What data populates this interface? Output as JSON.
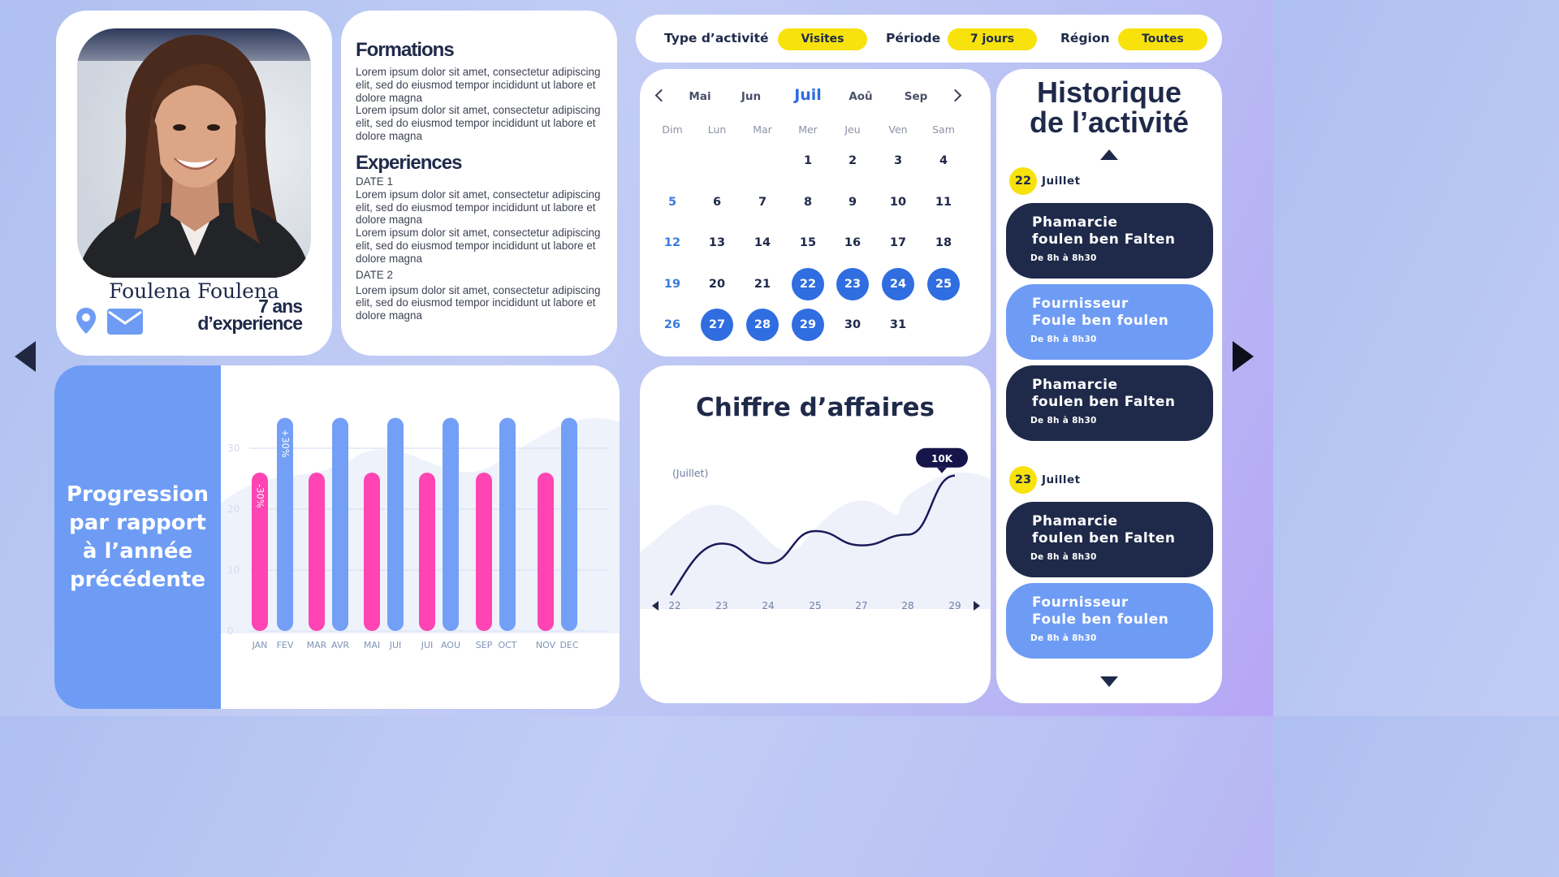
{
  "profile": {
    "name": "Foulena Foulena",
    "experience_line1": "7 ans",
    "experience_line2": "d’experience"
  },
  "cv": {
    "formations_heading": "Formations",
    "formations_items": [
      "Lorem ipsum dolor sit amet, consectetur adipiscing elit, sed do eiusmod tempor incididunt ut labore et dolore magna",
      "Lorem ipsum dolor sit amet, consectetur adipiscing elit, sed do eiusmod tempor incididunt ut labore et dolore magna"
    ],
    "experiences_heading": "Experiences",
    "date1": "DATE 1",
    "date1_items": [
      "Lorem ipsum dolor sit amet, consectetur adipiscing elit, sed do eiusmod tempor incididunt ut labore et dolore magna",
      "Lorem ipsum dolor sit amet, consectetur adipiscing elit, sed do eiusmod tempor incididunt ut labore et dolore magna"
    ],
    "date2": "DATE 2",
    "date2_items": [
      "Lorem ipsum dolor sit amet, consectetur adipiscing elit, sed do eiusmod tempor incididunt ut labore et dolore magna"
    ]
  },
  "filters": {
    "type_label": "Type d’activité",
    "type_value": "Visites",
    "period_label": "Période",
    "period_value": "7 jours",
    "region_label": "Région",
    "region_value": "Toutes"
  },
  "calendar": {
    "months": [
      "Mai",
      "Jun",
      "Juil",
      "Aoû",
      "Sep"
    ],
    "active_month": "Juil",
    "weekdays": [
      "Dim",
      "Lun",
      "Mar",
      "Mer",
      "Jeu",
      "Ven",
      "Sam"
    ],
    "first_weekday_index": 3,
    "days_in_month": 31,
    "selected_days": [
      22,
      23,
      24,
      25,
      27,
      28,
      29
    ],
    "accent_color": "#2f6de0"
  },
  "history": {
    "title_line1": "Historique",
    "title_line2": "de l’activité",
    "groups": [
      {
        "day": "22",
        "month": "Juillet",
        "items": [
          {
            "line1": "Phamarcie",
            "line2": "foulen ben Falten",
            "time": "De 8h à 8h30",
            "style": "dark"
          },
          {
            "line1": "Fournisseur",
            "line2": "Foule ben foulen",
            "time": "De 8h à 8h30",
            "style": "light"
          },
          {
            "line1": "Phamarcie",
            "line2": "foulen ben Falten",
            "time": "De 8h à 8h30",
            "style": "dark"
          }
        ]
      },
      {
        "day": "23",
        "month": "Juillet",
        "items": [
          {
            "line1": "Phamarcie",
            "line2": "foulen ben Falten",
            "time": "De 8h à 8h30",
            "style": "dark"
          },
          {
            "line1": "Fournisseur",
            "line2": "Foule ben foulen",
            "time": "De 8h à 8h30",
            "style": "light"
          }
        ]
      }
    ]
  },
  "progression": {
    "title": "Progression par rapport à l’année précédente"
  },
  "revenue": {
    "title": "Chiffre d’affaires",
    "subtitle": "(Juillet)",
    "peak_label": "10K"
  },
  "chart_data": [
    {
      "type": "bar",
      "categories": [
        "JAN",
        "FEV",
        "MAR",
        "AVR",
        "MAI",
        "JUI",
        "JUI",
        "AOU",
        "SEP",
        "OCT",
        "NOV",
        "DEC"
      ],
      "series": [
        {
          "values": [
            26,
            35,
            26,
            35,
            26,
            35,
            26,
            35,
            26,
            35,
            26,
            35
          ],
          "color": "#ff44b3",
          "color_alt": "#73a0f6"
        }
      ],
      "bar_colors": [
        "#ff44b3",
        "#73a0f6",
        "#ff44b3",
        "#73a0f6",
        "#ff44b3",
        "#73a0f6",
        "#ff44b3",
        "#73a0f6",
        "#ff44b3",
        "#73a0f6",
        "#ff44b3",
        "#73a0f6"
      ],
      "bar_labels": [
        "-30%",
        "+30%",
        "",
        "",
        "",
        "",
        "",
        "",
        "",
        "",
        "",
        ""
      ],
      "yticks": [
        0,
        10,
        20,
        30
      ],
      "ylim": [
        0,
        36
      ],
      "grid": true
    },
    {
      "type": "line",
      "x": [
        "22",
        "23",
        "24",
        "25",
        "27",
        "28",
        "29"
      ],
      "values": [
        3.0,
        4.3,
        3.2,
        5.0,
        4.2,
        4.8,
        8.1
      ],
      "peak_label": "10K",
      "ylim": [
        0,
        10
      ],
      "grid": false
    }
  ]
}
